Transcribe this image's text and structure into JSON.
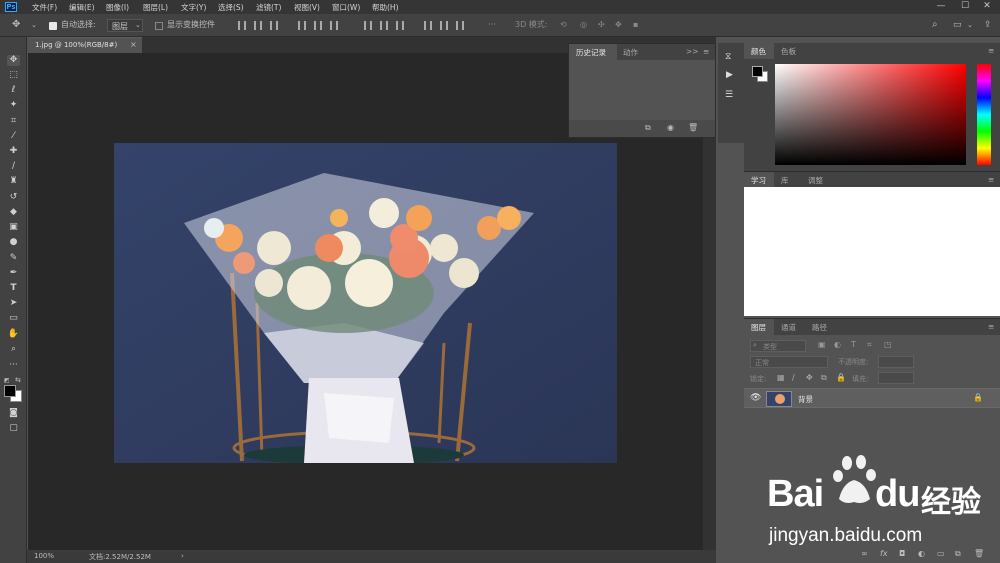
{
  "app": {
    "logo": "Ps"
  },
  "menubar": {
    "items": [
      "文件(F)",
      "编辑(E)",
      "图像(I)",
      "图层(L)",
      "文字(Y)",
      "选择(S)",
      "滤镜(T)",
      "视图(V)",
      "窗口(W)",
      "帮助(H)"
    ],
    "window_controls": {
      "minimize": "—",
      "maximize": "☐",
      "close": "✕"
    }
  },
  "options_bar": {
    "auto_select_label": "自动选择:",
    "auto_select_value": "图层",
    "show_transform_label": "显示变换控件",
    "mode_3d_label": "3D 模式:"
  },
  "document": {
    "tab_title": "1.jpg @ 100%(RGB/8#)",
    "close_glyph": "×"
  },
  "status_bar": {
    "zoom": "100%",
    "doc_info": "文档:2.52M/2.52M",
    "arrow": "›"
  },
  "history_panel": {
    "tabs": [
      "历史记录",
      "动作"
    ],
    "menu_glyph": ">>"
  },
  "color_panel": {
    "tabs": [
      "颜色",
      "色板"
    ]
  },
  "learn_panel": {
    "tabs": [
      "学习",
      "库",
      "调整"
    ]
  },
  "layers_panel": {
    "tabs": [
      "图层",
      "通道",
      "路径"
    ],
    "filter_placeholder": "类型",
    "blend_mode": "正常",
    "opacity_label": "不透明度:",
    "lock_label": "锁定:",
    "fill_label": "填充:",
    "layers": [
      {
        "name": "背景",
        "visible": true,
        "locked": true
      }
    ],
    "footer_icons": [
      "link-icon",
      "fx-icon",
      "mask-icon",
      "adjustment-icon",
      "group-icon",
      "new-layer-icon",
      "trash-icon"
    ]
  },
  "watermark": {
    "brand": "Bai",
    "brand2": "du",
    "chinese": "经验",
    "url": "jingyan.baidu.com"
  },
  "colors": {
    "accent": "#31a8ff",
    "foreground": "#000000",
    "background": "#ffffff"
  }
}
